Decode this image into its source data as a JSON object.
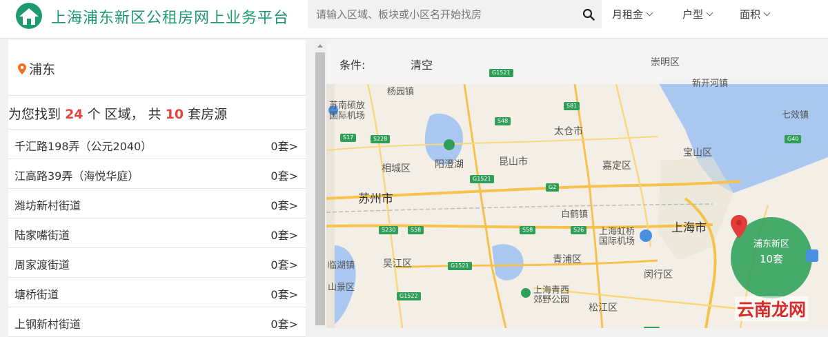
{
  "header": {
    "title": "上海浦东新区公租房网上业务平台",
    "search_placeholder": "请输入区域、板块或小区名开始找房",
    "filters": [
      "月租金",
      "户型",
      "面积"
    ]
  },
  "left_panel": {
    "district": "浦东",
    "result": {
      "prefix": "为您找到",
      "areas_count": "24",
      "middle": "个 区域， 共",
      "houses_count": "10",
      "suffix": "套房源"
    },
    "items": [
      {
        "name": "千汇路198弄（公元2040）",
        "count": "0套>"
      },
      {
        "name": "江高路39弄（海悦华庭）",
        "count": "0套>"
      },
      {
        "name": "潍坊新村街道",
        "count": "0套>"
      },
      {
        "name": "陆家嘴街道",
        "count": "0套>"
      },
      {
        "name": "周家渡街道",
        "count": "0套>"
      },
      {
        "name": "塘桥街道",
        "count": "0套>"
      },
      {
        "name": "上钢新村街道",
        "count": "0套>"
      }
    ]
  },
  "map": {
    "condition_label": "条件:",
    "clear_label": "清空",
    "cluster": {
      "name": "浦东新区",
      "count": "10套"
    },
    "watermark": "云南龙网",
    "labels": {
      "suzhou": "苏州市",
      "shanghai": "上海市",
      "kunshan": "昆山市",
      "taicang": "太仓市",
      "xiangcheng": "相城区",
      "yangcheng": "阳澄湖",
      "jiading": "嘉定区",
      "baoshan": "宝山区",
      "qingpu": "青浦区",
      "wujiang": "吴江区",
      "minhang": "闵行区",
      "songjiang": "松江区",
      "chongming": "崇明区",
      "airport_sz": "苏南硕放国际机场",
      "airport_hq": "上海虹桥国际机场",
      "park": "上海青西郊野公园",
      "baihe": "白鹤镇",
      "yangqiao": "杨园镇",
      "qixia": "七效镇",
      "xinkai": "新开河镇",
      "linhu": "临湖镇",
      "shanjing": "山景区"
    },
    "colors": {
      "accent": "#1e9a72",
      "cluster": "#2ea05a",
      "highlight": "#e64340"
    }
  }
}
